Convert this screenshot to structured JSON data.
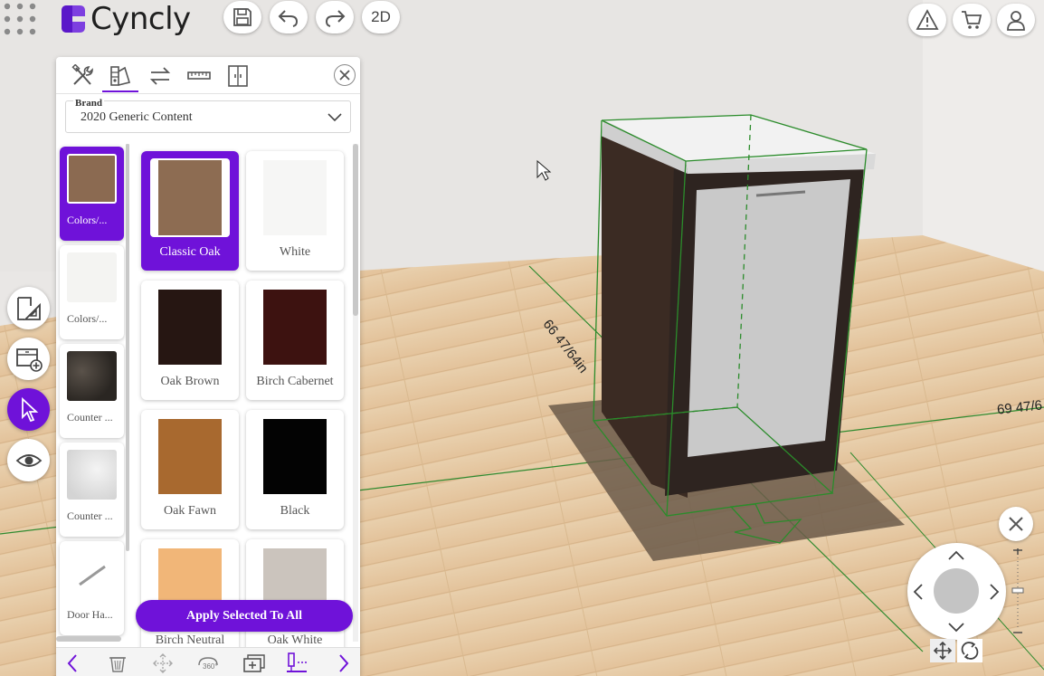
{
  "app": {
    "logo_text": "Cyncly",
    "view_toggle_label": "2D"
  },
  "toolbar": {
    "icons": [
      "grid-menu-icon",
      "save-icon",
      "undo-icon",
      "redo-icon"
    ],
    "right_icons": [
      "warning-icon",
      "cart-icon",
      "user-icon"
    ]
  },
  "left_tools": [
    "floorplan-icon",
    "add-cabinet-icon",
    "select-pointer-icon",
    "visibility-eye-icon"
  ],
  "panel": {
    "tabs": [
      "tools-icon",
      "materials-icon",
      "swap-icon",
      "ruler-icon",
      "door-icon"
    ],
    "brand": {
      "label": "Brand",
      "value": "2020 Generic Content"
    },
    "categories": [
      {
        "label": "Colors/...",
        "color": "#8b6a51",
        "active": true
      },
      {
        "label": "Colors/...",
        "color": "#f4f4f2",
        "active": false
      },
      {
        "label": "Counter ...",
        "color": "#3a3530",
        "active": false
      },
      {
        "label": "Counter ...",
        "color": "#e8e8e8",
        "active": false
      },
      {
        "label": "Door Ha...",
        "color": "#ffffff",
        "active": false
      }
    ],
    "materials": [
      {
        "label": "Classic Oak",
        "color": "#8d6c52",
        "active": true
      },
      {
        "label": "White",
        "color": "#f6f6f5",
        "active": false
      },
      {
        "label": "Oak Brown",
        "color": "#261612",
        "active": false
      },
      {
        "label": "Birch Cabernet",
        "color": "#3d1210",
        "active": false
      },
      {
        "label": "Oak Fawn",
        "color": "#a8692f",
        "active": false
      },
      {
        "label": "Black",
        "color": "#030303",
        "active": false
      },
      {
        "label": "Birch Neutral",
        "color": "#f1b678",
        "active": false
      },
      {
        "label": "Oak White",
        "color": "#cbc4bd",
        "active": false
      }
    ],
    "apply_label": "Apply Selected To All",
    "bottom_icons": [
      "prev-arrow-icon",
      "delete-icon",
      "move-icon",
      "rotate-360-icon",
      "duplicate-icon",
      "align-icon",
      "next-arrow-icon"
    ]
  },
  "dimensions": {
    "depth_label": "66 47/64in",
    "width_label": "69 47/6"
  },
  "colors": {
    "accent": "#6f12d9",
    "floor": "#e6c7a0",
    "cabinet_body": "#3b2b23",
    "door": "#c9c9c9"
  }
}
